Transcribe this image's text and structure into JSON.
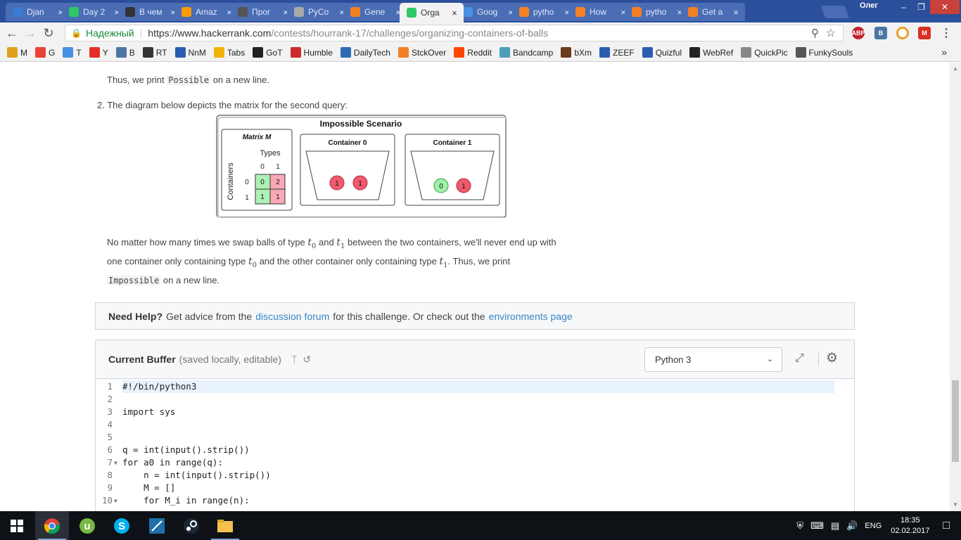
{
  "browser": {
    "tabs": [
      {
        "title": "Djan",
        "icon": "django-icon",
        "color": "#3a7bd5"
      },
      {
        "title": "Day 2",
        "icon": "hackerrank-icon",
        "color": "#2ec866"
      },
      {
        "title": "В чем",
        "icon": "skull-icon",
        "color": "#333"
      },
      {
        "title": "Amaz",
        "icon": "amazon-icon",
        "color": "#f90"
      },
      {
        "title": "Прог",
        "icon": "bird-icon",
        "color": "#555"
      },
      {
        "title": "PyCo",
        "icon": "page-icon",
        "color": "#aaa"
      },
      {
        "title": "Gene",
        "icon": "flag-icon",
        "color": "#f48024"
      },
      {
        "title": "Orga",
        "icon": "hackerrank-icon",
        "color": "#2ec866",
        "active": true
      },
      {
        "title": "Goog",
        "icon": "google-translate-icon",
        "color": "#4a90e2"
      },
      {
        "title": "pytho",
        "icon": "stackoverflow-icon",
        "color": "#f48024"
      },
      {
        "title": "How",
        "icon": "stackoverflow-icon",
        "color": "#f48024"
      },
      {
        "title": "pytho",
        "icon": "stackoverflow-icon",
        "color": "#f48024"
      },
      {
        "title": "Get a",
        "icon": "stackoverflow-icon",
        "color": "#f48024"
      }
    ],
    "user": "Олег",
    "secure_label": "Надежный",
    "url_host": "https://www.hackerrank.com",
    "url_path": "/contests/hourrank-17/challenges/organizing-containers-of-balls",
    "extensions": [
      "ABP",
      "B"
    ],
    "bookmarks": [
      {
        "label": "M",
        "icon": "toggl-icon",
        "color": "#e0a21e"
      },
      {
        "label": "G",
        "icon": "google-icon",
        "color": "#ea4335"
      },
      {
        "label": "T",
        "icon": "translate-icon",
        "color": "#4a90e2"
      },
      {
        "label": "Y",
        "icon": "youtube-icon",
        "color": "#e52d27"
      },
      {
        "label": "B",
        "icon": "vk-icon",
        "color": "#4c75a3"
      },
      {
        "label": "RT",
        "icon": "rt-icon",
        "color": "#333"
      },
      {
        "label": "NnM",
        "icon": "nnm-icon",
        "color": "#2a5db0"
      },
      {
        "label": "Tabs",
        "icon": "tabs-icon",
        "color": "#f2b400"
      },
      {
        "label": "GoT",
        "icon": "got-icon",
        "color": "#222"
      },
      {
        "label": "Humble",
        "icon": "humble-icon",
        "color": "#cc2929"
      },
      {
        "label": "DailyTech",
        "icon": "dailytech-icon",
        "color": "#2f6bb5"
      },
      {
        "label": "StckOver",
        "icon": "stackoverflow-icon",
        "color": "#f48024"
      },
      {
        "label": "Reddit",
        "icon": "reddit-icon",
        "color": "#ff4500"
      },
      {
        "label": "Bandcamp",
        "icon": "bandcamp-icon",
        "color": "#4e9fb8"
      },
      {
        "label": "bXm",
        "icon": "bxm-icon",
        "color": "#6b3a1f"
      },
      {
        "label": "ZEEF",
        "icon": "zeef-icon",
        "color": "#2a5db0"
      },
      {
        "label": "Quizful",
        "icon": "quizful-icon",
        "color": "#2a5db0"
      },
      {
        "label": "WebRef",
        "icon": "chat-icon",
        "color": "#222"
      },
      {
        "label": "QuickPic",
        "icon": "page-icon",
        "color": "#888"
      },
      {
        "label": "FunkySouls",
        "icon": "funkysouls-icon",
        "color": "#555"
      }
    ]
  },
  "problem": {
    "thus_prefix": "Thus, we print",
    "possible": "Possible",
    "newline_suffix": "on a new line.",
    "query2_intro": "2. The diagram below depicts the matrix for the second query:",
    "diagram": {
      "title": "Impossible Scenario",
      "matrix_title": "Matrix M",
      "types_label": "Types",
      "containers_label": "Containers",
      "col_headers": [
        "0",
        "1"
      ],
      "row_headers": [
        "0",
        "1"
      ],
      "cells": [
        [
          "0",
          "2"
        ],
        [
          "1",
          "1"
        ]
      ],
      "container0_label": "Container 0",
      "container0_balls": [
        "1",
        "1"
      ],
      "container1_label": "Container 1",
      "container1_balls": [
        "0",
        "1"
      ],
      "green": "#aef0b5",
      "pink": "#f7a9b7",
      "red_ball": "#f05a6e",
      "green_ball": "#9ff0a6"
    },
    "exp_1": "No matter how many times we swap balls of type",
    "t0": "t",
    "and": "and",
    "exp_2": "between the two containers, we'll never end up with",
    "exp_3": "one container only containing type",
    "exp_4": "and the other container only containing type",
    "exp_5": ". Thus, we print",
    "impossible": "Impossible"
  },
  "help": {
    "bold": "Need Help?",
    "t1": "Get advice from the",
    "link1": "discussion forum",
    "t2": "for this challenge. Or check out the",
    "link2": "environments page"
  },
  "editor": {
    "title": "Current Buffer",
    "subtitle": "(saved locally, editable)",
    "language": "Python 3",
    "lines": [
      {
        "n": "1",
        "text": "#!/bin/python3"
      },
      {
        "n": "2",
        "text": ""
      },
      {
        "n": "3",
        "text": "import sys"
      },
      {
        "n": "4",
        "text": ""
      },
      {
        "n": "5",
        "text": ""
      },
      {
        "n": "6",
        "text": "q = int(input().strip())"
      },
      {
        "n": "7",
        "text": "for a0 in range(q):"
      },
      {
        "n": "8",
        "text": "    n = int(input().strip())"
      },
      {
        "n": "9",
        "text": "    M = []"
      },
      {
        "n": "10",
        "text": "    for M_i in range(n):"
      }
    ]
  },
  "taskbar": {
    "lang": "ENG",
    "time": "18:35",
    "date": "02.02.2017"
  }
}
